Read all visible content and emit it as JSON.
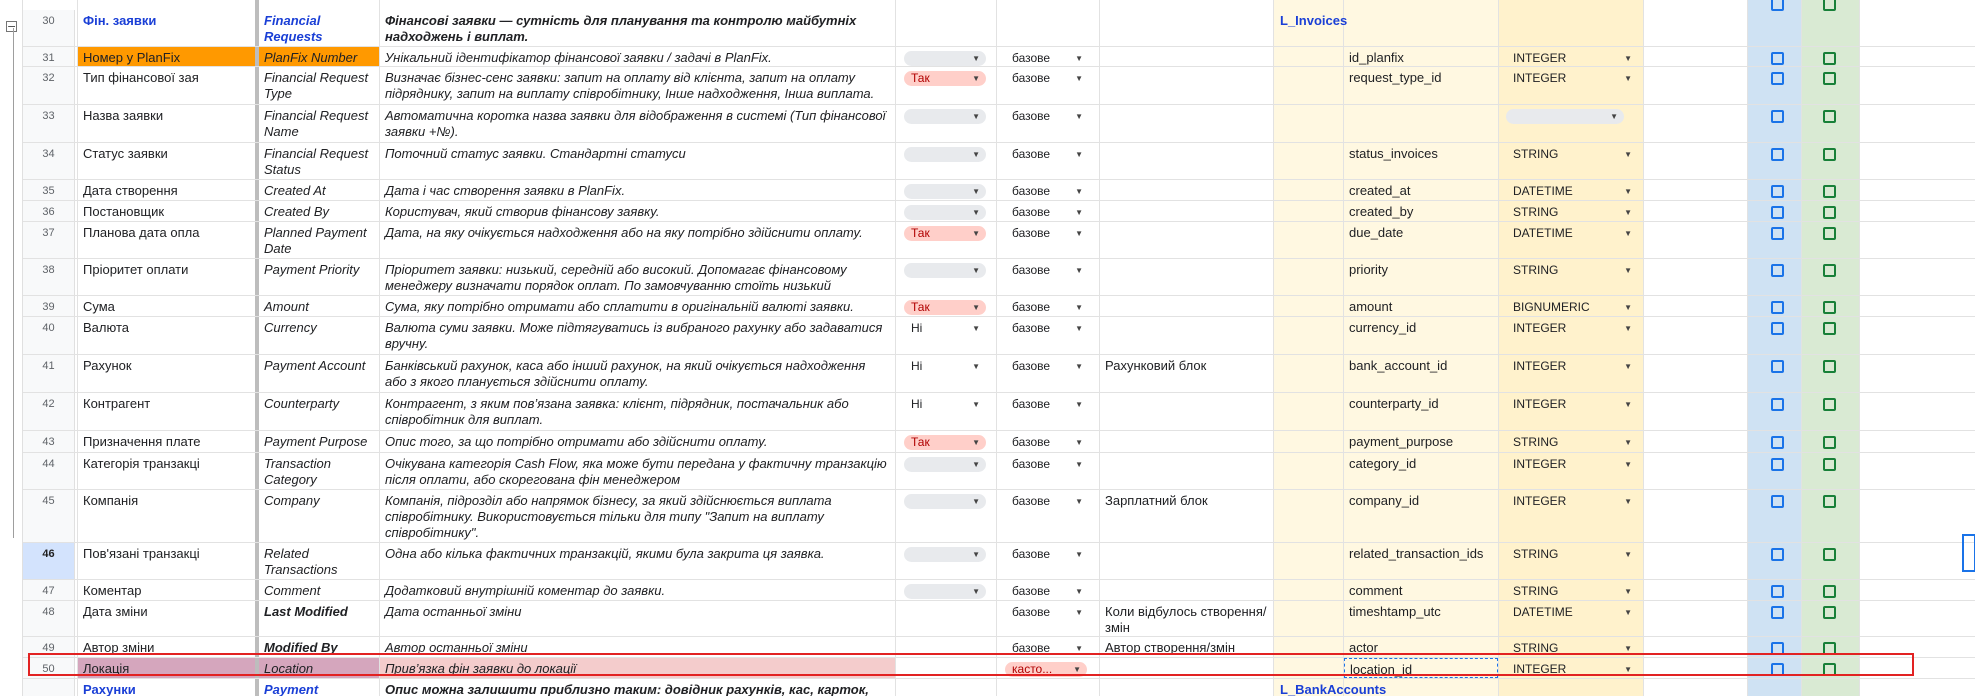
{
  "rows": [
    {
      "num": "30",
      "hdr": true,
      "ua": "Фін. заявки",
      "en": "Financial Requests",
      "desc": "Фінансові заявки — сутність для планування та контролю майбутніх надходжень і виплат.",
      "table": "L_Invoices"
    },
    {
      "num": "31",
      "ua": "Номер у PlanFix",
      "en": "PlanFix Number",
      "desc": "Унікальний ідентифікатор фінансової заявки / задачі в PlanFix.",
      "req": "",
      "level": "базове",
      "field": "id_planfix",
      "type": "INTEGER",
      "orange": true
    },
    {
      "num": "32",
      "ua": "Тип фінансової зая",
      "en": "Financial Request Type",
      "desc": "Визначає бізнес-сенс заявки: запит на оплату від клієнта, запит на оплату підряднику, запит на виплату співробітнику, Інше надходження, Інша виплата.",
      "req": "Так",
      "level": "базове",
      "field": "request_type_id",
      "type": "INTEGER"
    },
    {
      "num": "33",
      "ua": "Назва заявки",
      "en": "Financial Request Name",
      "desc": "Автоматична коротка назва заявки для відображення в системі (Тип фінансової заявки +№).",
      "req": "",
      "level": "базове",
      "field": "",
      "type": ""
    },
    {
      "num": "34",
      "ua": "Статус заявки",
      "en": "Financial Request Status",
      "desc": "Поточний статус заявки. Стандартні статуси",
      "req": "",
      "level": "базове",
      "field": "status_invoices",
      "type": "STRING"
    },
    {
      "num": "35",
      "ua": "Дата створення",
      "en": "Created At",
      "desc": "Дата і час створення заявки в PlanFix.",
      "req": "",
      "level": "базове",
      "field": "created_at",
      "type": "DATETIME"
    },
    {
      "num": "36",
      "ua": "Постановщик",
      "en": "Created By",
      "desc": "Користувач, який створив фінансову заявку.",
      "req": "",
      "level": "базове",
      "field": "created_by",
      "type": "STRING"
    },
    {
      "num": "37",
      "ua": "Планова дата опла",
      "en": "Planned Payment Date",
      "desc": "Дата, на яку очікується надходження або на яку потрібно здійснити оплату.",
      "req": "Так",
      "level": "базове",
      "field": "due_date",
      "type": "DATETIME"
    },
    {
      "num": "38",
      "ua": "Пріоритет оплати",
      "en": "Payment Priority",
      "desc": "Пріоритет заявки: низький, середній або високий. Допомагає фінансовому менеджеру визначати порядок оплат. По замовчуванню стоїть низький",
      "req": "",
      "level": "базове",
      "field": "priority",
      "type": "STRING"
    },
    {
      "num": "39",
      "ua": "Сума",
      "en": "Amount",
      "desc": "Сума, яку потрібно отримати або сплатити в оригінальній валюті заявки.",
      "req": "Так",
      "level": "базове",
      "field": "amount",
      "type": "BIGNUMERIC"
    },
    {
      "num": "40",
      "ua": "Валюта",
      "en": "Currency",
      "desc": "Валюта суми заявки. Може підтягуватись із вибраного рахунку або задаватися вручну.",
      "req": "Ні",
      "level": "базове",
      "field": "currency_id",
      "type": "INTEGER"
    },
    {
      "num": "41",
      "ua": "Рахунок",
      "en": "Payment Account",
      "desc": "Банківський рахунок, каса або інший рахунок, на який очікується надходження або з якого планується здійснити оплату.",
      "req": "Ні",
      "level": "базове",
      "block": "Рахунковий блок",
      "field": "bank_account_id",
      "type": "INTEGER"
    },
    {
      "num": "42",
      "ua": "Контрагент",
      "en": "Counterparty",
      "desc": "Контрагент, з яким пов’язана заявка: клієнт, підрядник, постачальник або співробітник для виплат.",
      "req": "Ні",
      "level": "базове",
      "field": "counterparty_id",
      "type": "INTEGER"
    },
    {
      "num": "43",
      "ua": "Призначення плате",
      "en": "Payment Purpose",
      "desc": "Опис того, за що потрібно отримати або здійснити оплату.",
      "req": "Так",
      "level": "базове",
      "field": "payment_purpose",
      "type": "STRING"
    },
    {
      "num": "44",
      "ua": "Категорія транзакці",
      "en": "Transaction Category",
      "desc": "Очікувана категорія Cash Flow, яка може бути передана у фактичну транзакцію після оплати, або скорегована фін менеджером",
      "req": "",
      "level": "базове",
      "field": "category_id",
      "type": "INTEGER"
    },
    {
      "num": "45",
      "ua": "Компанія",
      "en": "Company",
      "desc": "Компанія, підрозділ або напрямок бізнесу, за який здійснюється виплата співробітнику. Використовується тільки для типу \"Запит на виплату співробітнику\".",
      "req": "",
      "level": "базове",
      "block": "Зарплатний блок",
      "field": "company_id",
      "type": "INTEGER"
    },
    {
      "num": "46",
      "ua": "Пов'язані транзакці",
      "en": "Related Transactions",
      "desc": "Одна або кілька фактичних транзакцій, якими була закрита ця заявка.",
      "req": "",
      "level": "базове",
      "field": "related_transaction_ids",
      "type": "STRING"
    },
    {
      "num": "47",
      "ua": "Коментар",
      "en": "Comment",
      "desc": "Додатковий внутрішній коментар до заявки.",
      "req": "",
      "level": "базове",
      "field": "comment",
      "type": "STRING"
    },
    {
      "num": "48",
      "ua": "Дата зміни",
      "en": "Last Modified",
      "desc": "Дата останньої зміни",
      "level": "базове",
      "block": "Коли відбулось створення/змін",
      "field": "timeshtamp_utc",
      "type": "DATETIME",
      "enbold": true
    },
    {
      "num": "49",
      "ua": "Автор зміни",
      "en": "Modified By",
      "desc": "Автор останньої зміни",
      "level": "базове",
      "block": "Автор створення/змін",
      "field": "actor",
      "type": "STRING",
      "enbold": true
    },
    {
      "num": "50",
      "ua": "Локація",
      "en": "Location",
      "desc": "Прив’язка фін заявки до локації",
      "level": "касто...",
      "levelred": true,
      "field": "location_id",
      "type": "INTEGER",
      "pink": true
    },
    {
      "num": "",
      "hdr": true,
      "ua": "Рахунки",
      "en": "Payment",
      "desc": "Опис можна залишити приблизно таким: довідник рахунків, кас, карток,",
      "table": "L_BankAccounts"
    }
  ]
}
